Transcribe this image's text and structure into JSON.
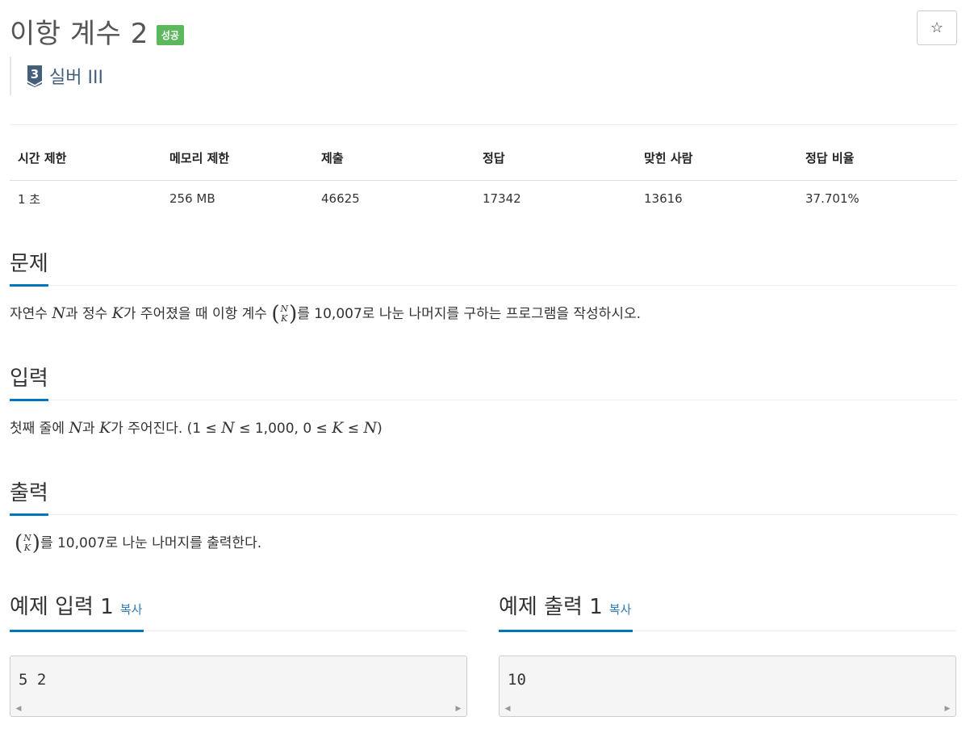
{
  "problem": {
    "title": "이항 계수 2",
    "status_badge": "성공",
    "star_icon": "☆",
    "tier_number": "3",
    "tier_label": "실버 III"
  },
  "info": {
    "headers": [
      "시간 제한",
      "메모리 제한",
      "제출",
      "정답",
      "맞힌 사람",
      "정답 비율"
    ],
    "values": [
      "1 초",
      "256 MB",
      "46625",
      "17342",
      "13616",
      "37.701%"
    ]
  },
  "sections": {
    "problem": {
      "title": "문제",
      "t1": "자연수 ",
      "N": "N",
      "t2": "과 정수 ",
      "K": "K",
      "t3": "가 주어졌을 때 이항 계수 ",
      "t4": "를 10,007로 나눈 나머지를 구하는 프로그램을 작성하시오."
    },
    "input": {
      "title": "입력",
      "t1": "첫째 줄에 ",
      "N": "N",
      "t2": "과 ",
      "K": "K",
      "t3": "가 주어진다. (1 ≤ ",
      "N2": "N",
      "t4": " ≤ 1,000, 0 ≤ ",
      "K2": "K",
      "t5": " ≤ ",
      "N3": "N",
      "t6": ")"
    },
    "output": {
      "title": "출력",
      "t1": "를 10,007로 나눈 나머지를 출력한다."
    }
  },
  "binom": {
    "open": "(",
    "close": ")",
    "top": "N",
    "bottom": "K"
  },
  "samples": {
    "input": {
      "title": "예제 입력 1",
      "copy": "복사",
      "content": "5 2"
    },
    "output": {
      "title": "예제 출력 1",
      "copy": "복사",
      "content": "10"
    },
    "scroll_left": "◀",
    "scroll_right": "▶"
  },
  "colors": {
    "badge": "#5cb85c",
    "accent": "#0076c0",
    "link": "#337ab7",
    "tier": "#435f7a"
  }
}
